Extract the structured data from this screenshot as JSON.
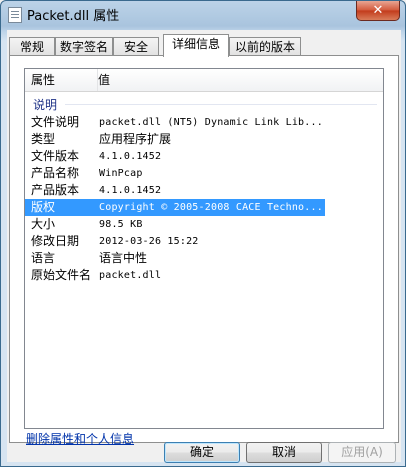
{
  "window": {
    "title": "Packet.dll 属性",
    "close_glyph": "✕"
  },
  "tabs": [
    {
      "label": "常规"
    },
    {
      "label": "数字签名"
    },
    {
      "label": "安全"
    },
    {
      "label": "详细信息",
      "active": true
    },
    {
      "label": "以前的版本"
    }
  ],
  "list": {
    "columns": {
      "property": "属性",
      "value": "值"
    },
    "group_label": "说明",
    "rows": [
      {
        "property": "文件说明",
        "value": "packet.dll (NT5) Dynamic Link Lib..."
      },
      {
        "property": "类型",
        "value": "应用程序扩展"
      },
      {
        "property": "文件版本",
        "value": "4.1.0.1452"
      },
      {
        "property": "产品名称",
        "value": "WinPcap"
      },
      {
        "property": "产品版本",
        "value": "4.1.0.1452"
      },
      {
        "property": "版权",
        "value": "Copyright © 2005-2008 CACE Techno...",
        "selected": true
      },
      {
        "property": "大小",
        "value": "98.5 KB"
      },
      {
        "property": "修改日期",
        "value": "2012-03-26 15:22"
      },
      {
        "property": "语言",
        "value": "语言中性"
      },
      {
        "property": "原始文件名",
        "value": "packet.dll"
      }
    ]
  },
  "remove_link": "删除属性和个人信息",
  "buttons": {
    "ok": "确定",
    "cancel": "取消",
    "apply": "应用(A)"
  },
  "colors": {
    "selection": "#3399ff",
    "group_text": "#1e3287",
    "link": "#0033aa",
    "close_button": "#c23a1b"
  }
}
